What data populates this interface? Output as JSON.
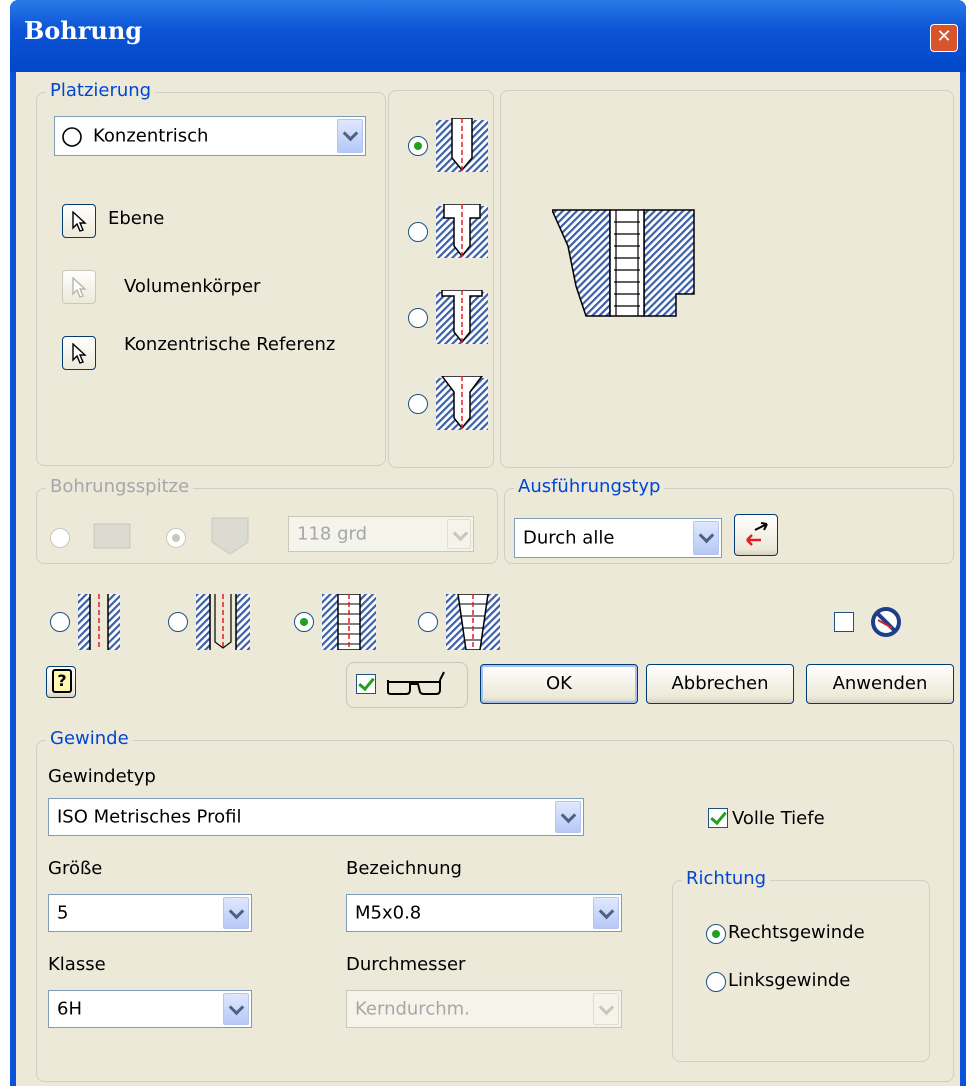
{
  "window": {
    "title": "Bohrung"
  },
  "placement": {
    "legend": "Platzierung",
    "type_value": "Konzentrisch",
    "selections": [
      {
        "label": "Ebene",
        "enabled": true
      },
      {
        "label": "Volumenkörper",
        "enabled": false
      },
      {
        "label": "Konzentrische Referenz",
        "enabled": true
      }
    ]
  },
  "hole_types": {
    "selected_index": 0,
    "options": [
      "simple",
      "counterbore",
      "spotface",
      "countersink"
    ]
  },
  "drill_point": {
    "legend": "Bohrungsspitze",
    "angle_value": "118 grd",
    "selected": "angled"
  },
  "termination": {
    "legend": "Ausführungstyp",
    "value": "Durch alle"
  },
  "hole_kind": {
    "selected_index": 2,
    "options": [
      "simple-hole",
      "clearance-hole",
      "tapped-hole",
      "taper-tapped-hole"
    ]
  },
  "buttons": {
    "ok": "OK",
    "cancel": "Abbrechen",
    "apply": "Anwenden"
  },
  "preview_checked": true,
  "thread": {
    "legend": "Gewinde",
    "type_label": "Gewindetyp",
    "type_value": "ISO Metrisches Profil",
    "full_depth_label": "Volle Tiefe",
    "full_depth_checked": true,
    "size_label": "Größe",
    "size_value": "5",
    "designation_label": "Bezeichnung",
    "designation_value": "M5x0.8",
    "class_label": "Klasse",
    "class_value": "6H",
    "diameter_label": "Durchmesser",
    "diameter_value": "Kerndurchm.",
    "direction": {
      "legend": "Richtung",
      "right_label": "Rechtsgewinde",
      "left_label": "Linksgewinde",
      "selected": "right"
    }
  },
  "colors": {
    "title_bar": "#0a52d8",
    "dialog_bg": "#ece9d8",
    "group_legend": "#0046d5",
    "hatch": "#3b5fa8",
    "axis": "#e02020"
  }
}
